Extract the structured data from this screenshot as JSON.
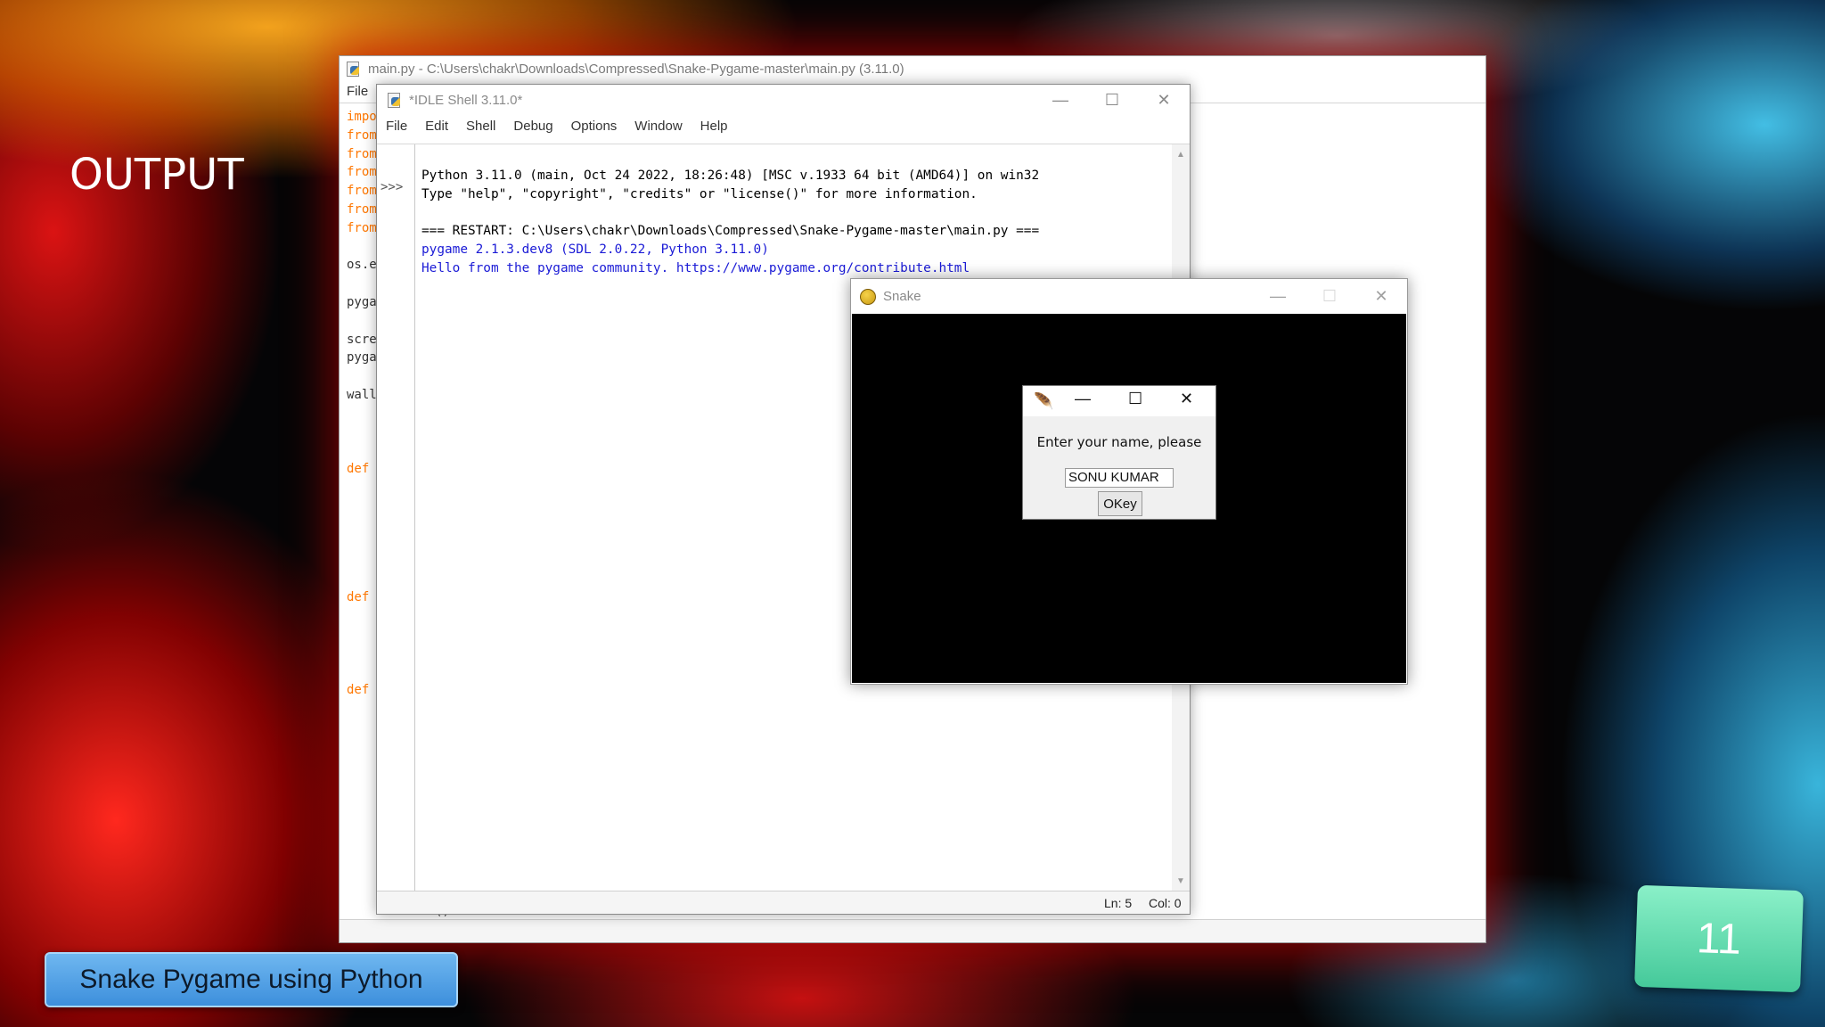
{
  "slide": {
    "heading": "OUTPUT",
    "footer": "Snake Pygame using Python",
    "page_number": "11"
  },
  "editor": {
    "title": "main.py - C:\\Users\\chakr\\Downloads\\Compressed\\Snake-Pygame-master\\main.py (3.11.0)",
    "menu_file": "File",
    "code_fragments": [
      "impo",
      "from",
      "from",
      "from",
      "from",
      "from",
      "from",
      "",
      "os.e",
      "",
      "pyga",
      "",
      "scre",
      "pyga",
      "",
      "wall",
      "",
      "",
      "",
      "def"
    ],
    "code_def_2": "def",
    "code_def_3": "def",
    "code_bottom": "f.close()"
  },
  "shell": {
    "title": "*IDLE Shell 3.11.0*",
    "menu": [
      "File",
      "Edit",
      "Shell",
      "Debug",
      "Options",
      "Window",
      "Help"
    ],
    "prompt": ">>>",
    "lines": [
      "Python 3.11.0 (main, Oct 24 2022, 18:26:48) [MSC v.1933 64 bit (AMD64)] on win32",
      "Type \"help\", \"copyright\", \"credits\" or \"license()\" for more information.",
      "",
      "=== RESTART: C:\\Users\\chakr\\Downloads\\Compressed\\Snake-Pygame-master\\main.py ===",
      "pygame 2.1.3.dev8 (SDL 2.0.22, Python 3.11.0)",
      "Hello from the pygame community. https://www.pygame.org/contribute.html"
    ],
    "status_ln": "Ln: 5",
    "status_col": "Col: 0"
  },
  "snake_window": {
    "title": "Snake"
  },
  "dialog": {
    "prompt": "Enter your name, please",
    "input_value": "SONU KUMAR",
    "ok_label": "OKey"
  },
  "icons": {
    "window_minimize": "minimize-icon",
    "window_maximize": "maximize-icon",
    "window_close": "close-icon",
    "python_file": "python-file-icon",
    "pygame": "pygame-icon",
    "tk_feather": "feather-icon"
  }
}
